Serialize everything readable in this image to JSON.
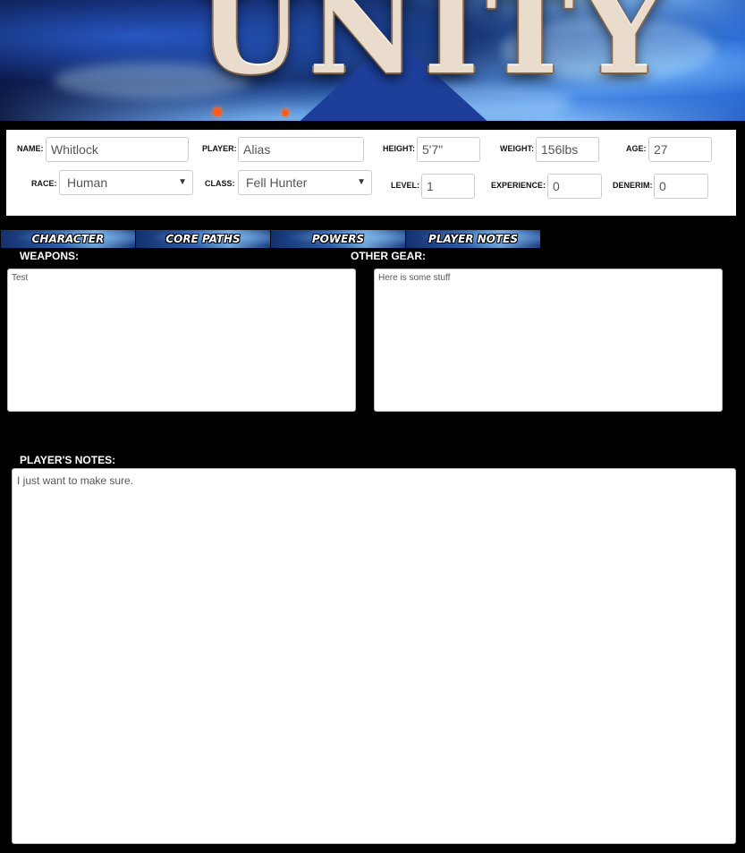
{
  "banner": {
    "logo_text": "UNITY"
  },
  "character": {
    "name_label": "NAME:",
    "name_value": "Whitlock",
    "player_label": "PLAYER:",
    "player_value": "Alias",
    "height_label": "HEIGHT:",
    "height_value": "5'7\"",
    "weight_label": "WEIGHT:",
    "weight_value": "156lbs",
    "age_label": "AGE:",
    "age_value": "27",
    "race_label": "RACE:",
    "race_value": "Human",
    "class_label": "CLASS:",
    "class_value": "Fell Hunter",
    "level_label": "LEVEL:",
    "level_value": "1",
    "experience_label": "EXPERIENCE:",
    "experience_value": "0",
    "denerim_label": "DENERIM:",
    "denerim_value": "0"
  },
  "tabs": [
    {
      "label": "CHARACTER"
    },
    {
      "label": "CORE PATHS"
    },
    {
      "label": "POWERS"
    },
    {
      "label": "PLAYER NOTES"
    }
  ],
  "notes": {
    "weapons_label": "WEAPONS:",
    "weapons_value": "Test",
    "other_gear_label": "OTHER GEAR:",
    "other_gear_value": "Here is some stuff",
    "players_notes_label": "PLAYER'S NOTES:",
    "players_notes_value": "I just want to make sure."
  },
  "colors": {
    "tab_blue": "#2d5ea8",
    "background": "#000000",
    "panel": "#ffffff"
  }
}
